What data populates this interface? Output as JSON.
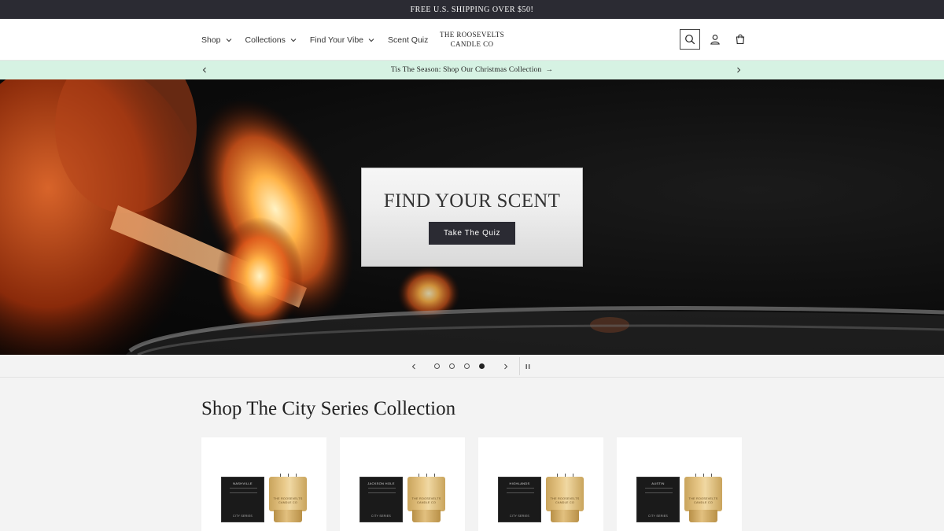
{
  "announcement": {
    "text": "FREE U.S. SHIPPING OVER $50!"
  },
  "header": {
    "nav": [
      {
        "label": "Shop",
        "has_dropdown": true
      },
      {
        "label": "Collections",
        "has_dropdown": true
      },
      {
        "label": "Find Your Vibe",
        "has_dropdown": true
      },
      {
        "label": "Scent Quiz",
        "has_dropdown": false
      }
    ],
    "logo": {
      "line1": "THE ROOSEVELTS",
      "line2": "CANDLE CO"
    },
    "icons": [
      "search-icon",
      "account-icon",
      "cart-icon"
    ]
  },
  "promo_bar": {
    "text": "Tis The Season: Shop Our Christmas Collection",
    "arrow": "→"
  },
  "hero": {
    "title": "FIND YOUR SCENT",
    "button_label": "Take The Quiz"
  },
  "slideshow": {
    "slide_count": 4,
    "active_slide": 4
  },
  "collection": {
    "title": "Shop The City Series Collection",
    "products": [
      {
        "box_label": "NASHVILLE",
        "box_footer": "CITY SERIES",
        "tin_label_1": "THE ROOSEVELTS",
        "tin_label_2": "CANDLE CO"
      },
      {
        "box_label": "JACKSON HOLE",
        "box_footer": "CITY SERIES",
        "tin_label_1": "THE ROOSEVELTS",
        "tin_label_2": "CANDLE CO"
      },
      {
        "box_label": "HIGHLANDS",
        "box_footer": "CITY SERIES",
        "tin_label_1": "THE ROOSEVELTS",
        "tin_label_2": "CANDLE CO"
      },
      {
        "box_label": "AUSTIN",
        "box_footer": "CITY SERIES",
        "tin_label_1": "THE ROOSEVELTS",
        "tin_label_2": "CANDLE CO"
      }
    ]
  },
  "colors": {
    "dark": "#2b2b33",
    "promo_bg": "#d6f2e3",
    "page_bg": "#f3f3f3"
  }
}
